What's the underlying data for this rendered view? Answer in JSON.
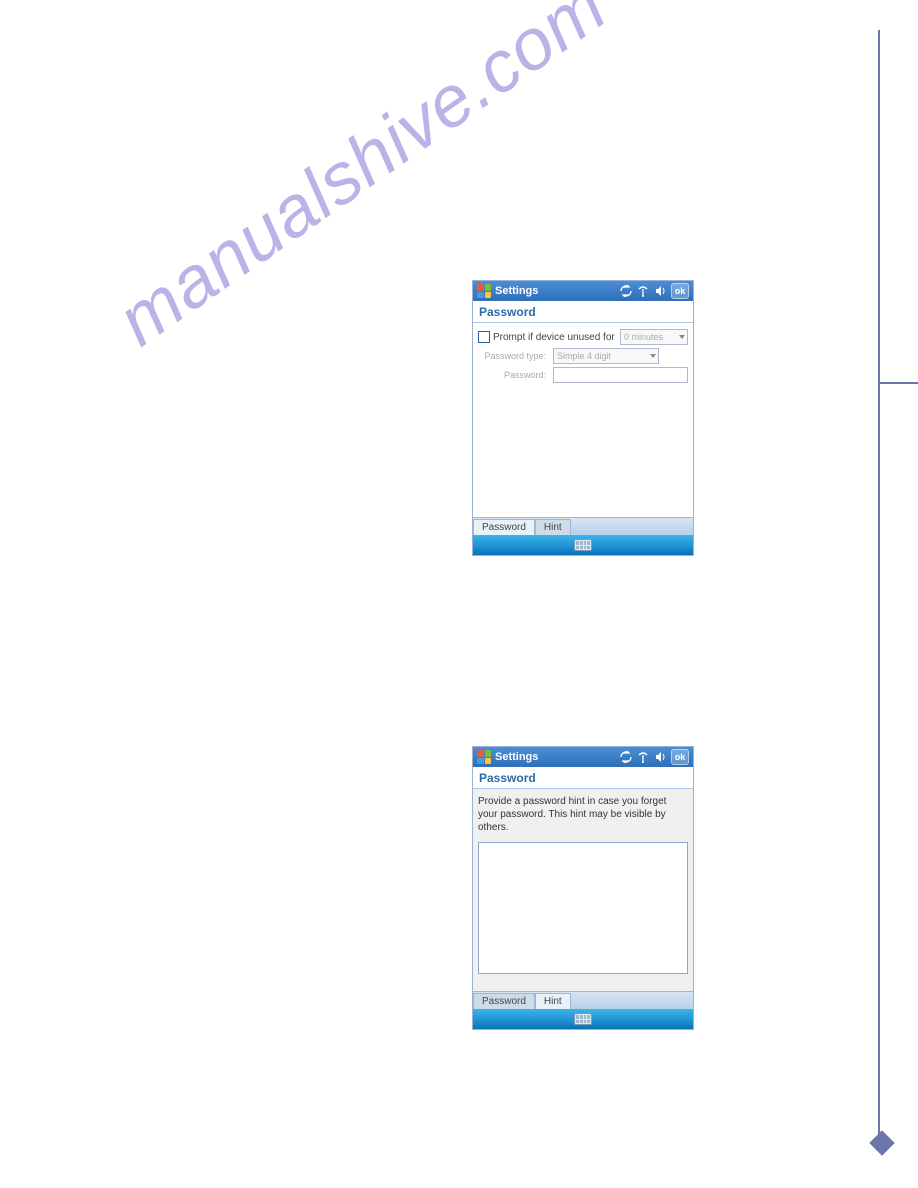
{
  "watermark": "manualshive.com",
  "shot1": {
    "titlebar": {
      "label": "Settings",
      "ok": "ok"
    },
    "header": "Password",
    "rows": {
      "prompt_label": "Prompt if device unused for",
      "timeout_value": "0 minutes",
      "type_label": "Password type:",
      "type_value": "Simple 4 digit",
      "password_label": "Password:"
    },
    "tabs": {
      "password": "Password",
      "hint": "Hint"
    }
  },
  "shot2": {
    "titlebar": {
      "label": "Settings",
      "ok": "ok"
    },
    "header": "Password",
    "hint_text": "Provide a password hint in case you forget your password.  This hint may be visible by others.",
    "tabs": {
      "password": "Password",
      "hint": "Hint"
    }
  }
}
